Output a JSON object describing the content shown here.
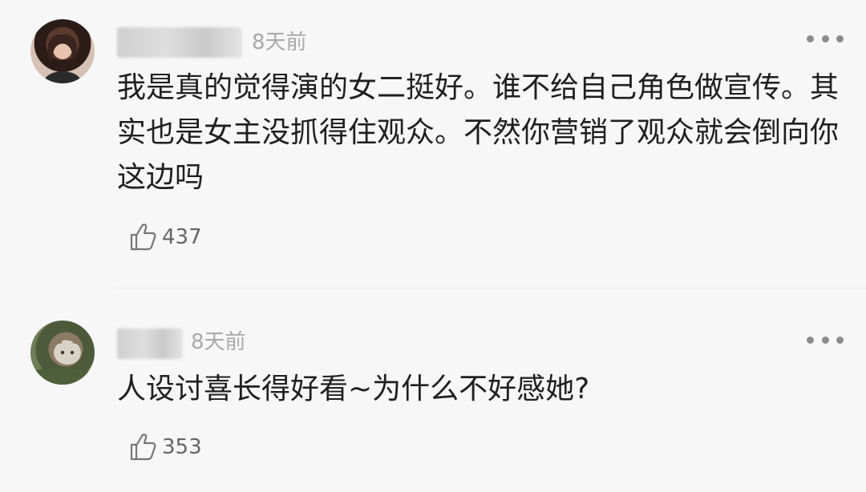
{
  "comments": [
    {
      "time": "8天前",
      "text": "我是真的觉得演的女二挺好。谁不给自己角色做宣传。其实也是女主没抓得住观众。不然你营销了观众就会倒向你这边吗",
      "likes": "437",
      "avatar_icon": "user-avatar-woman",
      "like_icon": "thumbs-up-icon",
      "more_icon": "more-dots-icon"
    },
    {
      "time": "8天前",
      "text": "人设讨喜长得好看~为什么不好感她?",
      "likes": "353",
      "avatar_icon": "user-avatar-cat",
      "like_icon": "thumbs-up-icon",
      "more_icon": "more-dots-icon"
    }
  ]
}
